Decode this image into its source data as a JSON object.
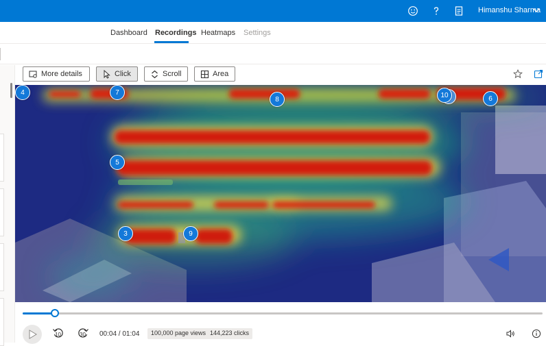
{
  "header": {
    "user_name": "Himanshu Sharma",
    "icons": [
      "smiley-icon",
      "help-icon",
      "document-icon",
      "chevron-down-icon"
    ]
  },
  "tabs": [
    {
      "label": "Dashboard",
      "state": "normal"
    },
    {
      "label": "Recordings",
      "state": "active"
    },
    {
      "label": "Heatmaps",
      "state": "normal"
    },
    {
      "label": "Settings",
      "state": "disabled"
    }
  ],
  "toolbar": {
    "more_details": "More details",
    "click": "Click",
    "scroll": "Scroll",
    "area": "Area",
    "selected": "Click"
  },
  "heatmap": {
    "markers": [
      "4",
      "7",
      "8",
      "10",
      "6",
      "5",
      "3",
      "9"
    ]
  },
  "player": {
    "progress_fraction": 0.0625,
    "time": "00:04 / 01:04",
    "skip_back": "10",
    "skip_forward": "30",
    "page_views": "100,000 page views",
    "clicks": "144,223 clicks"
  },
  "colors": {
    "brand": "#0078d4",
    "marker": "#1479d9",
    "heat_low": "#1d2a82",
    "heat_high": "#d21f0c"
  }
}
